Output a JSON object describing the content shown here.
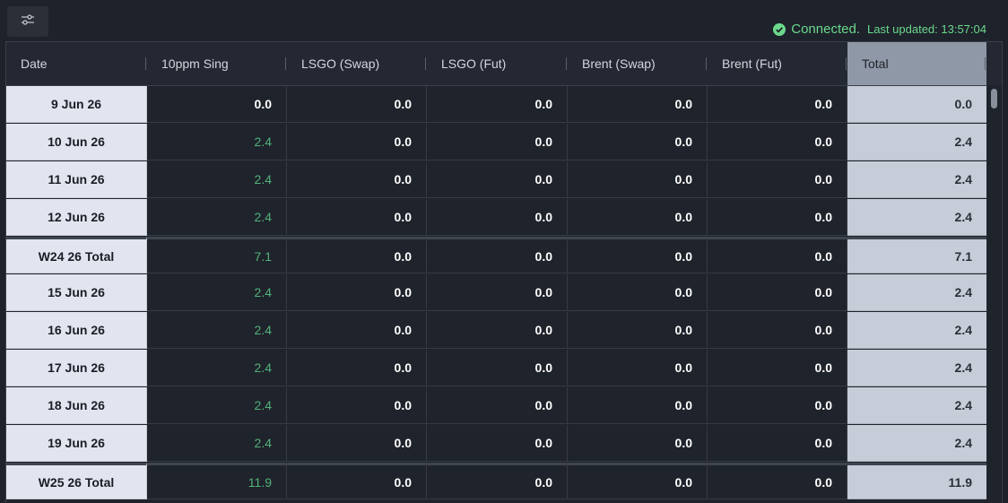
{
  "toolbar": {
    "settings_icon": "sliders-icon"
  },
  "status": {
    "connected_label": "Connected.",
    "last_updated": "Last updated: 13:57:04",
    "color": "#6bd98c"
  },
  "table": {
    "columns": [
      "Date",
      "10ppm Sing",
      "LSGO (Swap)",
      "LSGO (Fut)",
      "Brent (Swap)",
      "Brent (Fut)",
      "Total"
    ],
    "rows": [
      {
        "date": "9 Jun 26",
        "values": [
          "0.0",
          "0.0",
          "0.0",
          "0.0",
          "0.0"
        ],
        "total": "0.0",
        "kind": "day",
        "highlight_first": false
      },
      {
        "date": "10 Jun 26",
        "values": [
          "2.4",
          "0.0",
          "0.0",
          "0.0",
          "0.0"
        ],
        "total": "2.4",
        "kind": "day",
        "highlight_first": true
      },
      {
        "date": "11 Jun 26",
        "values": [
          "2.4",
          "0.0",
          "0.0",
          "0.0",
          "0.0"
        ],
        "total": "2.4",
        "kind": "day",
        "highlight_first": true
      },
      {
        "date": "12 Jun 26",
        "values": [
          "2.4",
          "0.0",
          "0.0",
          "0.0",
          "0.0"
        ],
        "total": "2.4",
        "kind": "day",
        "highlight_first": true
      },
      {
        "date": "W24 26 Total",
        "values": [
          "7.1",
          "0.0",
          "0.0",
          "0.0",
          "0.0"
        ],
        "total": "7.1",
        "kind": "subtotal",
        "highlight_first": true
      },
      {
        "date": "15 Jun 26",
        "values": [
          "2.4",
          "0.0",
          "0.0",
          "0.0",
          "0.0"
        ],
        "total": "2.4",
        "kind": "day",
        "highlight_first": true
      },
      {
        "date": "16 Jun 26",
        "values": [
          "2.4",
          "0.0",
          "0.0",
          "0.0",
          "0.0"
        ],
        "total": "2.4",
        "kind": "day",
        "highlight_first": true
      },
      {
        "date": "17 Jun 26",
        "values": [
          "2.4",
          "0.0",
          "0.0",
          "0.0",
          "0.0"
        ],
        "total": "2.4",
        "kind": "day",
        "highlight_first": true
      },
      {
        "date": "18 Jun 26",
        "values": [
          "2.4",
          "0.0",
          "0.0",
          "0.0",
          "0.0"
        ],
        "total": "2.4",
        "kind": "day",
        "highlight_first": true
      },
      {
        "date": "19 Jun 26",
        "values": [
          "2.4",
          "0.0",
          "0.0",
          "0.0",
          "0.0"
        ],
        "total": "2.4",
        "kind": "day",
        "highlight_first": true
      },
      {
        "date": "W25 26 Total",
        "values": [
          "11.9",
          "0.0",
          "0.0",
          "0.0",
          "0.0"
        ],
        "total": "11.9",
        "kind": "subtotal",
        "highlight_first": true
      }
    ]
  }
}
